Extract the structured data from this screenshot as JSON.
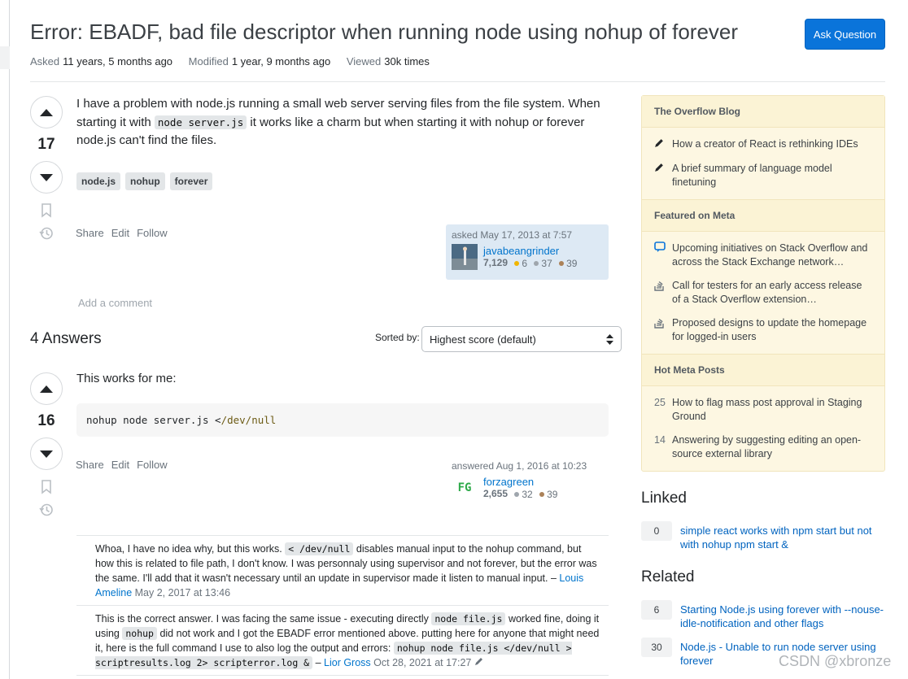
{
  "question": {
    "title": "Error: EBADF, bad file descriptor when running node using nohup of forever",
    "ask_button": "Ask Question",
    "meta": {
      "asked_label": "Asked",
      "asked_value": "11 years, 5 months ago",
      "modified_label": "Modified",
      "modified_value": "1 year, 9 months ago",
      "viewed_label": "Viewed",
      "viewed_value": "30k times"
    },
    "votes": "17",
    "body_1": "I have a problem with node.js running a small web server serving files from the file system. When starting it with ",
    "body_code": "node server.js",
    "body_2": " it works like a charm but when starting it with nohup or forever node.js can't find the files.",
    "tags": [
      "node.js",
      "nohup",
      "forever"
    ],
    "menu": {
      "share": "Share",
      "edit": "Edit",
      "follow": "Follow"
    },
    "asked_card": {
      "when": "asked May 17, 2013 at 7:57",
      "user": "javabeangrinder",
      "rep": "7,129",
      "gold": "6",
      "silver": "37",
      "bronze": "39"
    },
    "add_comment": "Add a comment"
  },
  "answers": {
    "heading": "4 Answers",
    "sorted_label": "Sorted by:",
    "sort_value": "Highest score (default)",
    "first": {
      "votes": "16",
      "body": "This works for me:",
      "code_cmd": "nohup node server.js <",
      "code_lit": "/dev/null",
      "menu": {
        "share": "Share",
        "edit": "Edit",
        "follow": "Follow"
      },
      "card": {
        "when": "answered Aug 1, 2016 at 10:23",
        "user": "forzagreen",
        "rep": "2,655",
        "silver": "32",
        "bronze": "39",
        "avatar_text": "FG"
      },
      "comments": [
        {
          "t1": "Whoa, I have no idea why, but this works. ",
          "code": "< /dev/null",
          "t2": " disables manual input to the nohup command, but how this is related to file path, I don't know. I was personnaly using supervisor and not forever, but the error was the same. I'll add that it wasn't necessary until an update in supervisor made it listen to manual input.",
          "sep": " – ",
          "author": "Louis Ameline",
          "date": " May 2, 2017 at 13:46"
        },
        {
          "t1": "This is the correct answer. I was facing the same issue - executing directly ",
          "code1": "node file.js",
          "t2": " worked fine, doing it using ",
          "code2": "nohup",
          "t3": " did not work and I got the EBADF error mentioned above. putting here for anyone that might need it, here is the full command I use to also log the output and errors: ",
          "code3": "nohup node file.js </dev/null > scriptresults.log 2> scripterror.log &",
          "sep": " – ",
          "author": "Lior Gross",
          "date": " Oct 28, 2021 at 17:27"
        }
      ]
    }
  },
  "sidebar": {
    "blog_head": "The Overflow Blog",
    "blog_items": [
      "How a creator of React is rethinking IDEs",
      "A brief summary of language model finetuning"
    ],
    "meta_head": "Featured on Meta",
    "meta_items": [
      "Upcoming initiatives on Stack Overflow and across the Stack Exchange network…",
      "Call for testers for an early access release of a Stack Overflow extension…",
      "Proposed designs to update the homepage for logged-in users"
    ],
    "hot_head": "Hot Meta Posts",
    "hot_items": [
      {
        "n": "25",
        "t": "How to flag mass post approval in Staging Ground"
      },
      {
        "n": "14",
        "t": "Answering by suggesting editing an open-source external library"
      }
    ],
    "linked_head": "Linked",
    "linked": [
      {
        "n": "0",
        "t": "simple react works with npm start but not with nohup npm start &"
      }
    ],
    "related_head": "Related",
    "related": [
      {
        "n": "6",
        "t": "Starting Node.js using forever with --nouse-idle-notification and other flags"
      },
      {
        "n": "30",
        "t": "Node.js - Unable to run node server using forever"
      }
    ]
  },
  "watermark": "CSDN @xbronze",
  "colors": {
    "accent": "#0a74da",
    "link": "#0074cc",
    "sidebar_bg": "#fdf7e2"
  }
}
